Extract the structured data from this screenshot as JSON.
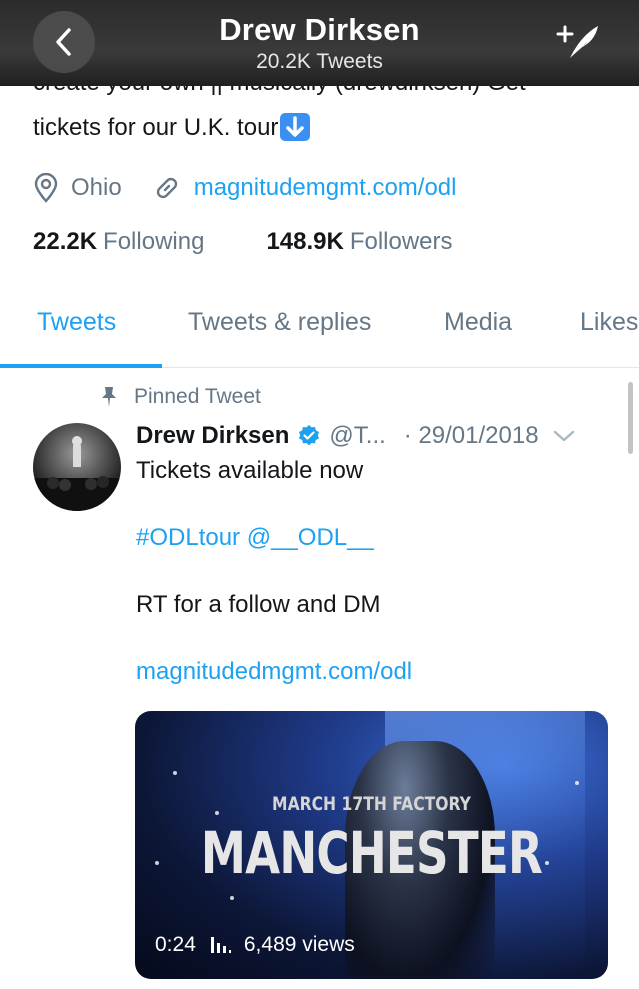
{
  "header": {
    "title": "Drew Dirksen",
    "subtitle": "20.2K Tweets",
    "back_icon": "chevron-left-icon",
    "compose_icon": "compose-tweet-icon"
  },
  "profile": {
    "bio_line1": "create your own || musically (drewdirksen) Get",
    "bio_line2": "tickets for our U.K. tour",
    "location": "Ohio",
    "website": "magnitudemgmt.com/odl",
    "following_count": "22.2K",
    "following_label": "Following",
    "followers_count": "148.9K",
    "followers_label": "Followers"
  },
  "tabs": [
    {
      "label": "Tweets",
      "active": true
    },
    {
      "label": "Tweets & replies",
      "active": false
    },
    {
      "label": "Media",
      "active": false
    },
    {
      "label": "Likes",
      "active": false
    }
  ],
  "tweet": {
    "pinned_label": "Pinned Tweet",
    "name": "Drew Dirksen",
    "handle": "@T...",
    "date": "· 29/01/2018",
    "line1": "Tickets available now",
    "line2": "#ODLtour @__ODL__",
    "line3": "RT for a follow and DM",
    "line4": "magnitudedmgmt.com/odl",
    "media": {
      "headline_small": "MARCH 17TH FACTORY",
      "headline_large": "MANCHESTER",
      "duration": "0:24",
      "views": "6,489 views"
    }
  },
  "colors": {
    "accent": "#1da1f2",
    "secondary_text": "#657786",
    "primary_text": "#14171a"
  }
}
